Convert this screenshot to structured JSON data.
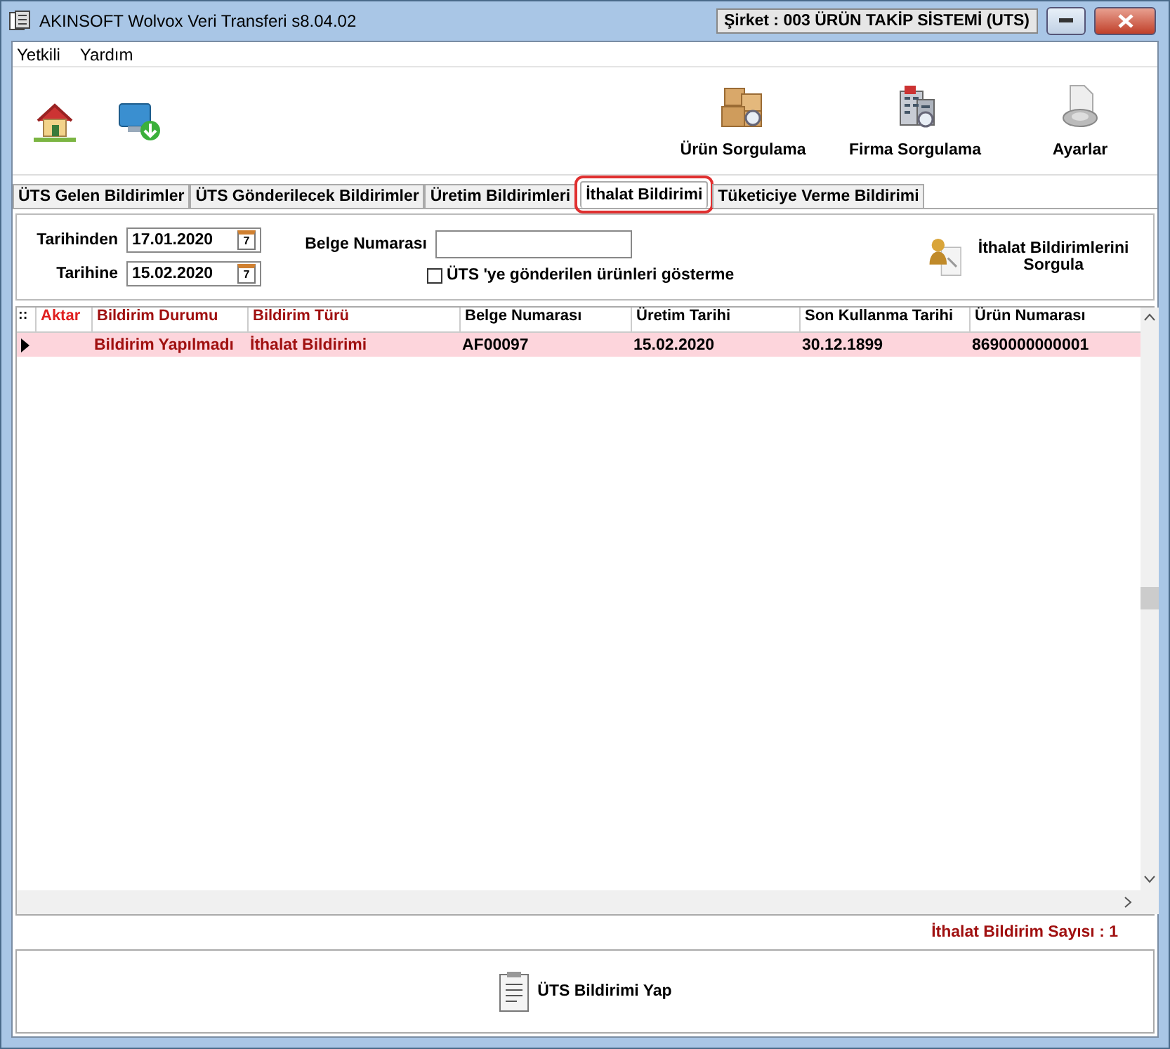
{
  "window": {
    "title": "AKINSOFT Wolvox Veri Transferi s8.04.02",
    "company": "Şirket : 003 ÜRÜN TAKİP SİSTEMİ (UTS)"
  },
  "menu": [
    "Yetkili",
    "Yardım"
  ],
  "toolbar": [
    {
      "kind": "home"
    },
    {
      "kind": "transfer"
    },
    {
      "kind": "boxes",
      "label": "Ürün Sorgulama"
    },
    {
      "kind": "building",
      "label": "Firma Sorgulama"
    },
    {
      "kind": "gear",
      "label": "Ayarlar"
    }
  ],
  "tabs": [
    {
      "label": "ÜTS Gelen Bildirimler",
      "selected": false
    },
    {
      "label": "ÜTS Gönderilecek Bildirimler",
      "selected": false
    },
    {
      "label": "Üretim Bildirimleri",
      "selected": false
    },
    {
      "label": "İthalat Bildirimi",
      "selected": true
    },
    {
      "label": "Tüketiciye Verme Bildirimi",
      "selected": false
    }
  ],
  "filters": {
    "from_label": "Tarihinden",
    "from_value": "17.01.2020",
    "from_calendar_day": "7",
    "to_label": "Tarihine",
    "to_value": "15.02.2020",
    "to_calendar_day": "7",
    "doc_label": "Belge Numarası",
    "hide_sent": {
      "label": "ÜTS 'ye gönderilen ürünleri gösterme",
      "checked": false
    },
    "query_button": "İthalat Bildirimlerini Sorgula"
  },
  "table": {
    "corner": "::",
    "columns": [
      "Aktar",
      "Bildirim Durumu",
      "Bildirim Türü",
      "Belge Numarası",
      "Üretim Tarihi",
      "Son Kullanma Tarihi",
      "Ürün Numarası"
    ],
    "rows": [
      {
        "selected": true,
        "cells": [
          "",
          "Bildirim Yapılmadı",
          "İthalat Bildirimi",
          "AF00097",
          "15.02.2020",
          "30.12.1899",
          "8690000000001"
        ]
      }
    ]
  },
  "count": "İthalat Bildirim Sayısı : 1",
  "send_button": "ÜTS Bildirimi Yap"
}
